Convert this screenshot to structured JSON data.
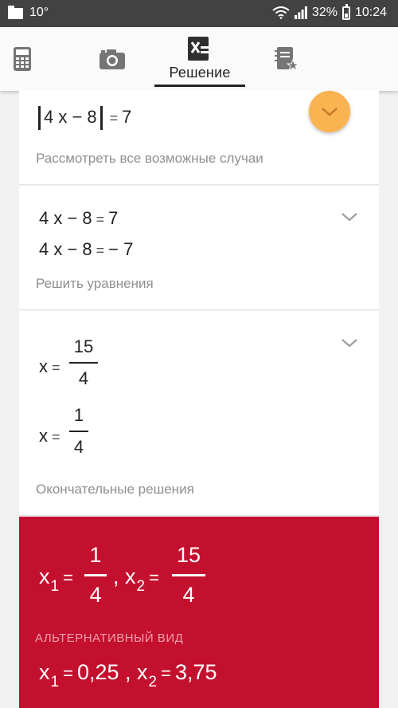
{
  "status_bar": {
    "temperature": "10°",
    "battery_percent": "32%",
    "time": "10:24"
  },
  "toolbar": {
    "active_tab_label": "Решение",
    "icons": [
      "calculator-icon",
      "camera-icon",
      "solution-icon",
      "notes-icon"
    ]
  },
  "steps": [
    {
      "expression": {
        "lhs": "4 x − 8",
        "rhs": "7"
      },
      "hint": "Рассмотреть все возможные случаи"
    },
    {
      "equations": [
        {
          "lhs": "4 x − 8",
          "rhs": "7"
        },
        {
          "lhs": "4 x − 8",
          "rhs": "− 7"
        }
      ],
      "hint": "Решить уравнения"
    },
    {
      "solutions": [
        {
          "var": "x",
          "num": "15",
          "den": "4"
        },
        {
          "var": "x",
          "num": "1",
          "den": "4"
        }
      ],
      "hint": "Окончательные решения"
    }
  ],
  "answer": {
    "x1": {
      "var": "x",
      "sub": "1",
      "num": "1",
      "den": "4"
    },
    "x2": {
      "var": "x",
      "sub": "2",
      "num": "15",
      "den": "4"
    },
    "alt_title": "АЛЬТЕРНАТИВНЫЙ ВИД",
    "alt_x1": "0,25",
    "alt_x2": "3,75"
  },
  "colors": {
    "answer_background": "#c4102f",
    "expand_button": "#f9b350",
    "status_bar": "#424242"
  }
}
